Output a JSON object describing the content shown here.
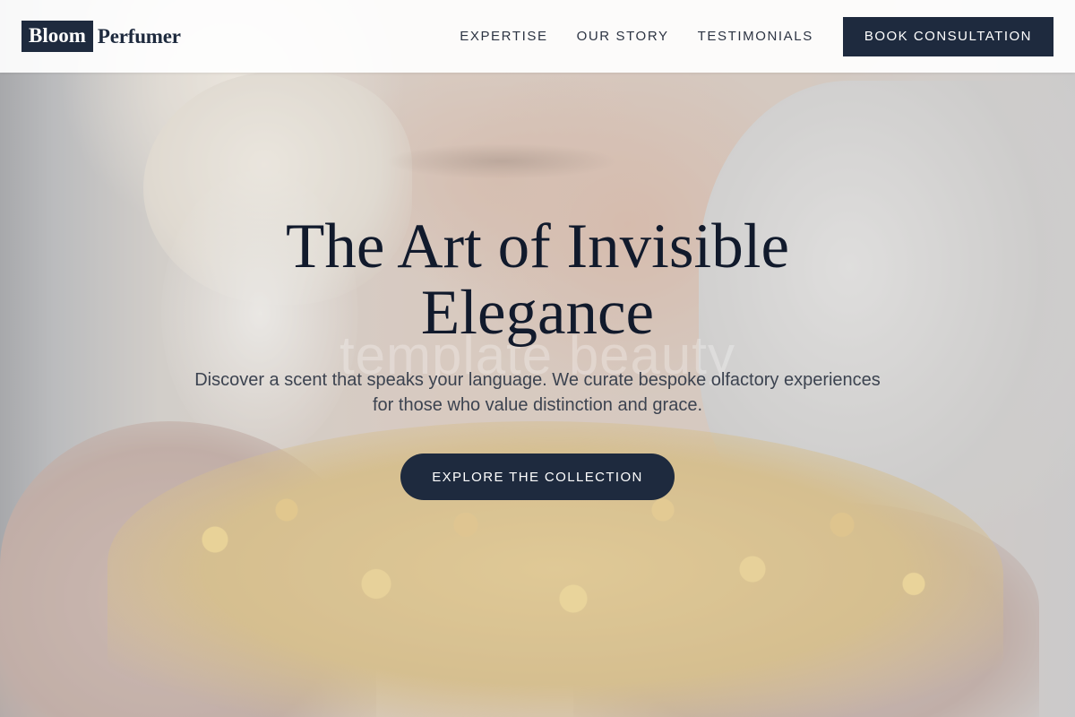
{
  "brand": {
    "logo_box_text": "Bloom",
    "logo_text": "Perfumer"
  },
  "nav": {
    "items": [
      {
        "label": "EXPERTISE"
      },
      {
        "label": "OUR STORY"
      },
      {
        "label": "TESTIMONIALS"
      }
    ],
    "cta_label": "BOOK CONSULTATION"
  },
  "hero": {
    "title_line1": "The Art of Invisible",
    "title_line2": "Elegance",
    "watermark": "template beauty",
    "subtitle_line1": "Discover a scent that speaks your language. We curate bespoke olfactory experiences",
    "subtitle_line2": "for those who value distinction and grace.",
    "cta_label": "EXPLORE THE COLLECTION",
    "image": "person-smelling-yellow-flowers"
  },
  "colors": {
    "navy": "#1e2a3e",
    "title": "#111a2c",
    "text": "#3c4350",
    "header_bg": "#ffffff"
  }
}
